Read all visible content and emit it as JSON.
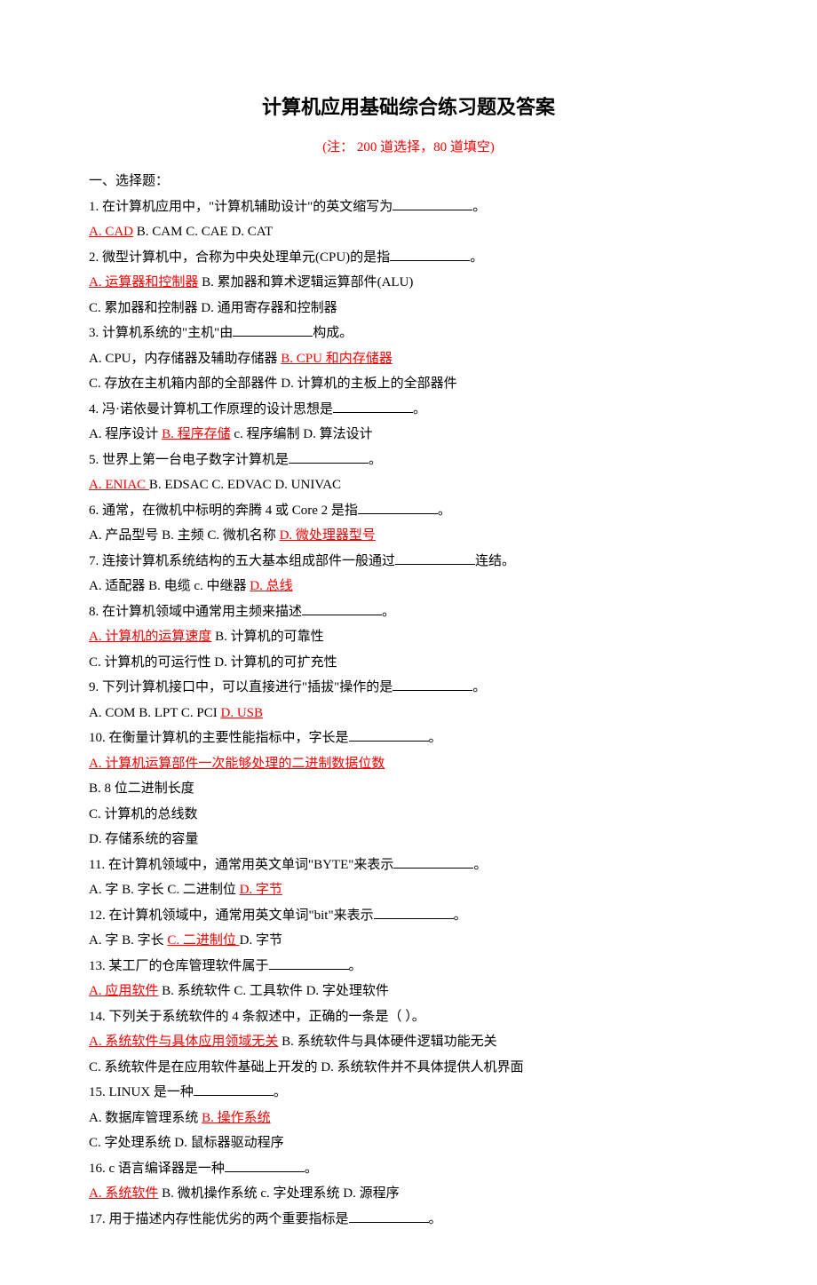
{
  "title": "计算机应用基础综合练习题及答案",
  "subtitle": "(注： 200 道选择，80 道填空)",
  "section": "一、选择题：",
  "questions": [
    {
      "stem": "1. 在计算机应用中，\"计算机辅助设计\"的英文缩写为",
      "tail": "。",
      "lines": [
        [
          {
            "t": "A. CAD",
            "a": true
          },
          {
            "t": "   B. CAM   C. CAE   D. CAT"
          }
        ]
      ]
    },
    {
      "stem": "2. 微型计算机中，合称为中央处理单元(CPU)的是指",
      "tail": "。",
      "lines": [
        [
          {
            "t": "A. 运算器和控制器",
            "a": true
          },
          {
            "t": "   B. 累加器和算术逻辑运算部件(ALU)"
          }
        ],
        [
          {
            "t": "C. 累加器和控制器   D. 通用寄存器和控制器"
          }
        ]
      ]
    },
    {
      "stem": "3. 计算机系统的\"主机\"由",
      "tail": "构成。",
      "lines": [
        [
          {
            "t": "A. CPU，内存储器及辅助存储器   "
          },
          {
            "t": "B. CPU 和内存储器",
            "a": true
          }
        ],
        [
          {
            "t": "C. 存放在主机箱内部的全部器件   D. 计算机的主板上的全部器件"
          }
        ]
      ]
    },
    {
      "stem": "4. 冯·诺依曼计算机工作原理的设计思想是",
      "tail": "。",
      "lines": [
        [
          {
            "t": "A. 程序设计   "
          },
          {
            "t": " B. 程序存储",
            "a": true
          },
          {
            "t": "    c. 程序编制   D. 算法设计"
          }
        ]
      ]
    },
    {
      "stem": "5. 世界上第一台电子数字计算机是",
      "tail": "。",
      "lines": [
        [
          {
            "t": "A. ENIAC ",
            "a": true
          },
          {
            "t": "   B. EDSAC   C. EDVAC   D. UNIVAC"
          }
        ]
      ]
    },
    {
      "stem": "6. 通常，在微机中标明的奔腾 4 或 Core 2 是指",
      "tail": "。",
      "lines": [
        [
          {
            "t": "A. 产品型号   B. 主频   C. 微机名称   "
          },
          {
            "t": " D. 微处理器型号",
            "a": true
          }
        ]
      ]
    },
    {
      "stem": "7. 连接计算机系统结构的五大基本组成部件一般通过",
      "tail": "连结。",
      "lines": [
        [
          {
            "t": "A. 适配器   B. 电缆   c. 中继器   "
          },
          {
            "t": "D. 总线",
            "a": true
          }
        ]
      ]
    },
    {
      "stem": "8. 在计算机领域中通常用主频来描述",
      "tail": "。",
      "lines": [
        [
          {
            "t": "A. 计算机的运算速度",
            "a": true
          },
          {
            "t": "   B. 计算机的可靠性"
          }
        ],
        [
          {
            "t": "C. 计算机的可运行性   D. 计算机的可扩充性"
          }
        ]
      ]
    },
    {
      "stem": "9. 下列计算机接口中，可以直接进行\"插拔\"操作的是",
      "tail": "。",
      "lines": [
        [
          {
            "t": "A. COM   B. LPT   C. PCI   "
          },
          {
            "t": " D. USB",
            "a": true
          }
        ]
      ]
    },
    {
      "stem": "10. 在衡量计算机的主要性能指标中，字长是",
      "tail": "。",
      "lines": [
        [
          {
            "t": "A. 计算机运算部件一次能够处理的二进制数据位数",
            "a": true
          }
        ],
        [
          {
            "t": "B. 8 位二进制长度"
          }
        ],
        [
          {
            "t": "C. 计算机的总线数"
          }
        ],
        [
          {
            "t": "D. 存储系统的容量"
          }
        ]
      ]
    },
    {
      "stem": "11. 在计算机领域中，通常用英文单词\"BYTE\"来表示",
      "tail": "。",
      "lines": [
        [
          {
            "t": "A. 字   B. 字长   C. 二进制位   "
          },
          {
            "t": " D. 字节",
            "a": true
          }
        ]
      ]
    },
    {
      "stem": "12. 在计算机领域中，通常用英文单词\"bit\"来表示",
      "tail": "。",
      "lines": [
        [
          {
            "t": "A. 字   B. 字长   "
          },
          {
            "t": "C. 二进制位 ",
            "a": true
          },
          {
            "t": "   D. 字节"
          }
        ]
      ]
    },
    {
      "stem": "13. 某工厂的仓库管理软件属于",
      "tail": "。",
      "lines": [
        [
          {
            "t": "A. 应用软件",
            "a": true
          },
          {
            "t": "   B. 系统软件   C. 工具软件   D. 字处理软件"
          }
        ]
      ]
    },
    {
      "stem": "14. 下列关于系统软件的 4 条叙述中，正确的一条是（ ）。",
      "noblank": true,
      "lines": [
        [
          {
            "t": "A. 系统软件与具体应用领域无关",
            "a": true
          },
          {
            "t": "   B. 系统软件与具体硬件逻辑功能无关"
          }
        ],
        [
          {
            "t": "C. 系统软件是在应用软件基础上开发的   D. 系统软件并不具体提供人机界面"
          }
        ]
      ]
    },
    {
      "stem": "15. LINUX 是一种",
      "tail": "。",
      "lines": [
        [
          {
            "t": "A. 数据库管理系统   "
          },
          {
            "t": "B. 操作系统",
            "a": true
          }
        ],
        [
          {
            "t": "C. 字处理系统     D. 鼠标器驱动程序"
          }
        ]
      ]
    },
    {
      "stem": "16. c 语言编译器是一种",
      "tail": "。",
      "lines": [
        [
          {
            "t": "A. 系统软件",
            "a": true
          },
          {
            "t": "   B. 微机操作系统  c. 字处理系统   D. 源程序"
          }
        ]
      ]
    },
    {
      "stem": "17. 用于描述内存性能优劣的两个重要指标是",
      "tail": "。",
      "lines": []
    }
  ]
}
